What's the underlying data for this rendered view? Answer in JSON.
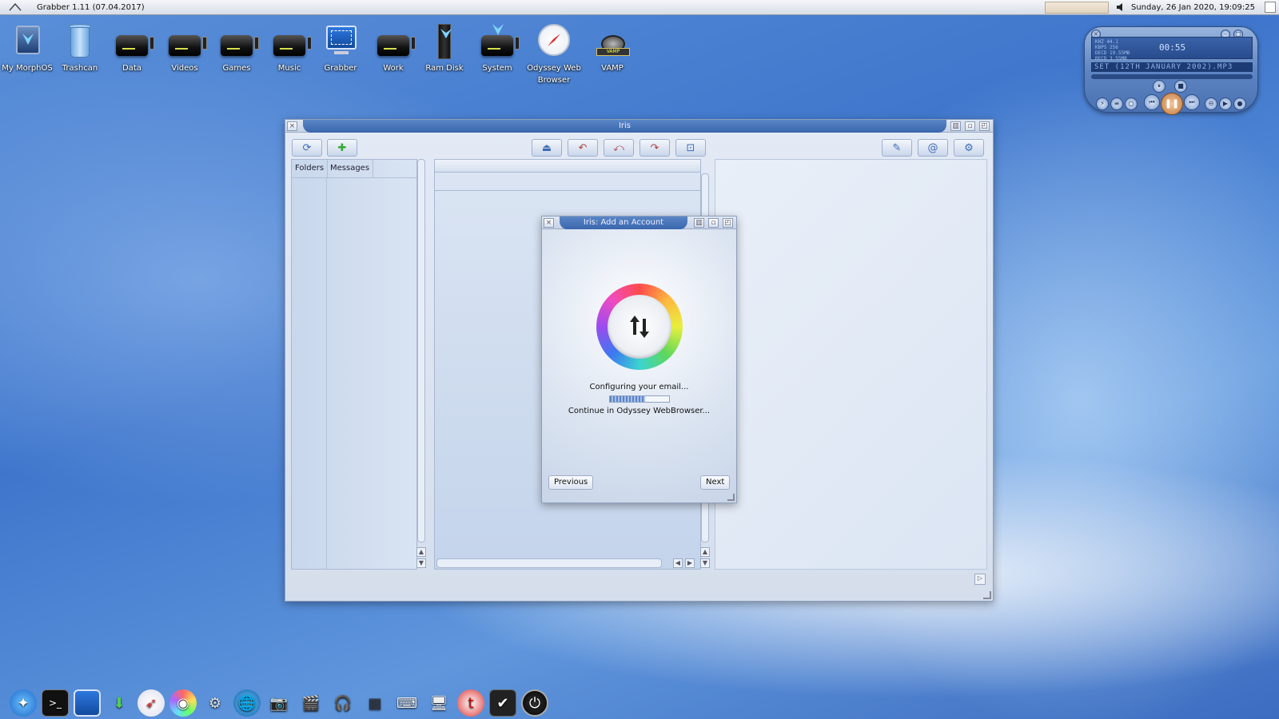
{
  "topbar": {
    "title": "Grabber 1.11 (07.04.2017)",
    "clock": "Sunday, 26 Jan 2020, 19:09:25"
  },
  "desktop_icons": [
    {
      "label": "My MorphOS",
      "icon": "morphos-icon"
    },
    {
      "label": "Trashcan",
      "icon": "trashcan-icon"
    },
    {
      "label": "Data",
      "icon": "drive-icon"
    },
    {
      "label": "Videos",
      "icon": "drive-icon"
    },
    {
      "label": "Games",
      "icon": "drive-icon"
    },
    {
      "label": "Music",
      "icon": "drive-icon"
    },
    {
      "label": "Grabber",
      "icon": "grabber-icon"
    },
    {
      "label": "Work",
      "icon": "drive-icon"
    },
    {
      "label": "Ram Disk",
      "icon": "ramdisk-icon"
    },
    {
      "label": "System",
      "icon": "system-drive-icon"
    },
    {
      "label": "Odyssey Web Browser",
      "icon": "compass-icon"
    },
    {
      "label": "VAMP",
      "icon": "film-reel-icon"
    }
  ],
  "iris": {
    "title": "Iris",
    "tabs": [
      "Folders",
      "Messages"
    ]
  },
  "dialog": {
    "title": "Iris: Add an Account",
    "status": "Configuring your email...",
    "continue_text": "Continue in Odyssey WebBrowser...",
    "progress": 0.6,
    "previous": "Previous",
    "next": "Next"
  },
  "player": {
    "time": "00:55",
    "track": "SET (12TH JANUARY 2002).MP3",
    "info_lines": [
      "KHZ 44.1",
      "KBPS 256",
      "DECD 19.55MB",
      "RECD 3.55MB"
    ]
  },
  "dock": [
    "ambient-icon",
    "shell-icon",
    "screen-icon",
    "download-icon",
    "odyssey-icon",
    "cd-icon",
    "vamp-icon",
    "globe-icon",
    "camera-icon",
    "clapper-icon",
    "headphones-icon",
    "piano-icon",
    "keyboard-icon",
    "monitor-icon",
    "twitter-icon",
    "check-icon",
    "power-icon"
  ],
  "colors": {
    "accent": "#3a66ad",
    "desktop": "#4a7ed0"
  }
}
